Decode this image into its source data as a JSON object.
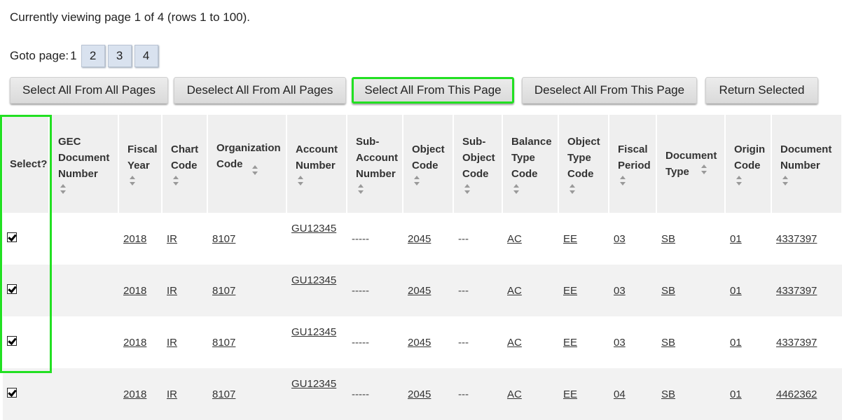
{
  "page_info": "Currently viewing page 1 of 4 (rows 1 to 100).",
  "goto": {
    "label": "Goto page:",
    "current": "1",
    "pages": [
      "2",
      "3",
      "4"
    ]
  },
  "actions": {
    "select_all_pages": "Select All From All Pages",
    "deselect_all_pages": "Deselect All From All Pages",
    "select_all_this_page": "Select All From This Page",
    "deselect_all_this_page": "Deselect All From This Page",
    "return_selected": "Return Selected"
  },
  "columns": {
    "select": "Select?",
    "gec_document_number": [
      "GEC",
      "Document",
      "Number"
    ],
    "fiscal_year": [
      "Fiscal",
      "Year"
    ],
    "chart_code": [
      "Chart",
      "Code"
    ],
    "organization_code": [
      "Organization",
      "Code"
    ],
    "account_number": [
      "Account",
      "Number"
    ],
    "sub_account_number": [
      "Sub-",
      "Account",
      "Number"
    ],
    "object_code": [
      "Object",
      "Code"
    ],
    "sub_object_code": [
      "Sub-",
      "Object",
      "Code"
    ],
    "balance_type_code": [
      "Balance",
      "Type",
      "Code"
    ],
    "object_type_code": [
      "Object",
      "Type",
      "Code"
    ],
    "fiscal_period": [
      "Fiscal",
      "Period"
    ],
    "document_type": [
      "Document",
      "Type"
    ],
    "origin_code": [
      "Origin",
      "Code"
    ],
    "document_number": [
      "Document",
      "Number"
    ]
  },
  "rows": [
    {
      "fiscal_year": "2018",
      "chart_code": "IR",
      "organization_code": "8107",
      "account_number": "GU12345",
      "sub_account_number": "-----",
      "object_code": "2045",
      "sub_object_code": "---",
      "balance_type_code": "AC",
      "object_type_code": "EE",
      "fiscal_period": "03",
      "document_type": "SB",
      "origin_code": "01",
      "document_number": "4337397"
    },
    {
      "fiscal_year": "2018",
      "chart_code": "IR",
      "organization_code": "8107",
      "account_number": "GU12345",
      "sub_account_number": "-----",
      "object_code": "2045",
      "sub_object_code": "---",
      "balance_type_code": "AC",
      "object_type_code": "EE",
      "fiscal_period": "03",
      "document_type": "SB",
      "origin_code": "01",
      "document_number": "4337397"
    },
    {
      "fiscal_year": "2018",
      "chart_code": "IR",
      "organization_code": "8107",
      "account_number": "GU12345",
      "sub_account_number": "-----",
      "object_code": "2045",
      "sub_object_code": "---",
      "balance_type_code": "AC",
      "object_type_code": "EE",
      "fiscal_period": "03",
      "document_type": "SB",
      "origin_code": "01",
      "document_number": "4337397"
    },
    {
      "fiscal_year": "2018",
      "chart_code": "IR",
      "organization_code": "8107",
      "account_number": "GU12345",
      "sub_account_number": "-----",
      "object_code": "2045",
      "sub_object_code": "---",
      "balance_type_code": "AC",
      "object_type_code": "EE",
      "fiscal_period": "04",
      "document_type": "SB",
      "origin_code": "01",
      "document_number": "4462362"
    }
  ],
  "colors": {
    "highlight": "#22e022",
    "header_bg": "#efefef",
    "page_button_bg": "#d9e2ef"
  }
}
